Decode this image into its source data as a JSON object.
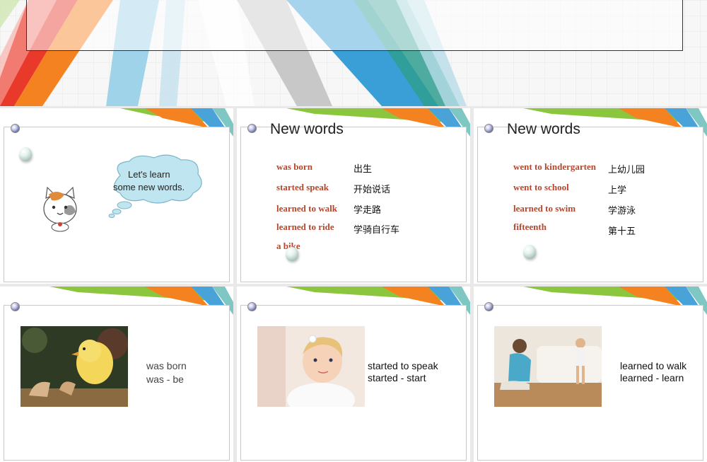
{
  "slides": {
    "s1": {
      "bubble_line1": "Let's learn",
      "bubble_line2": "some new words."
    },
    "s2": {
      "title": "New words",
      "rows": [
        {
          "en": "was born",
          "cn": "出生"
        },
        {
          "en": "started speak",
          "cn": "开始说话"
        },
        {
          "en": "learned to walk",
          "cn": "学走路"
        },
        {
          "en": "learned to ride",
          "cn": "学骑自行车"
        },
        {
          "en": "a bike",
          "cn": ""
        }
      ]
    },
    "s3": {
      "title": "New words",
      "rows": [
        {
          "en": "went to kindergarten",
          "cn": "上幼儿园"
        },
        {
          "en": "went to school",
          "cn": "上学"
        },
        {
          "en": "learned to swim",
          "cn": "学游泳"
        },
        {
          "en": "fifteenth",
          "cn": "第十五"
        }
      ]
    },
    "s4": {
      "line1": "was born",
      "line2": "was - be"
    },
    "s5": {
      "line1": "started to speak",
      "line2": "started - start"
    },
    "s6": {
      "line1": "learned to walk",
      "line2": "learned - learn"
    }
  },
  "colors": {
    "word": "#b5472d",
    "stripe_green": "#8cc63f",
    "stripe_orange": "#f58220",
    "stripe_blue": "#4aa3d8",
    "stripe_teal": "#2f9e8f",
    "stripe_red": "#e8392b"
  }
}
